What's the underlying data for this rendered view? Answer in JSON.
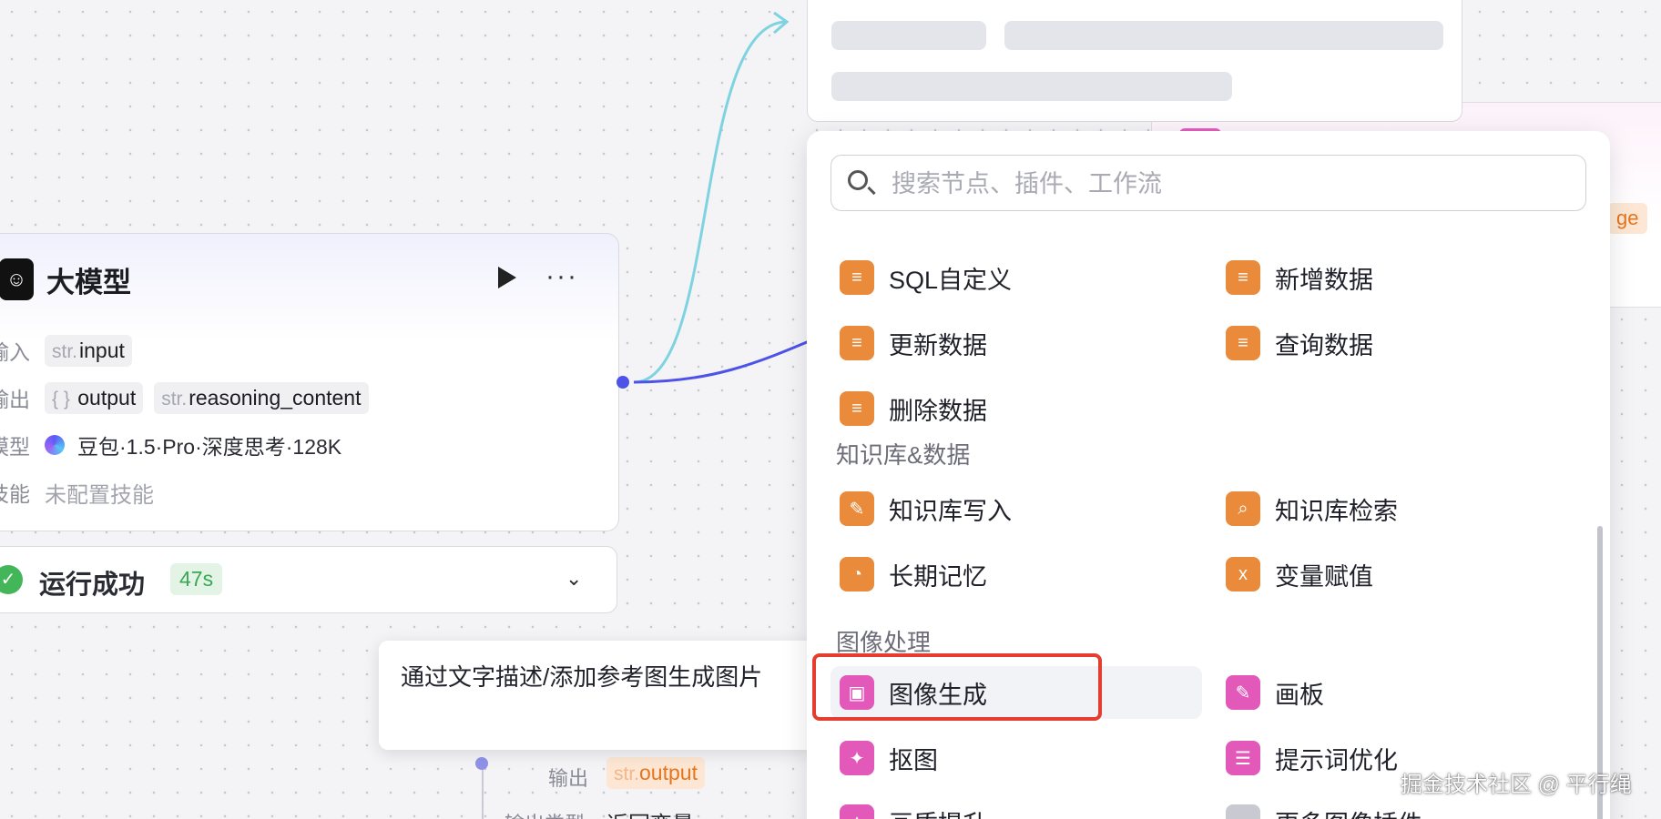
{
  "llm_node": {
    "title": "大模型",
    "input_label": "输入",
    "inputs": [
      {
        "type": "str.",
        "name": "input"
      }
    ],
    "output_label": "输出",
    "outputs": [
      {
        "type": "{ }",
        "name": "output"
      },
      {
        "type": "str.",
        "name": "reasoning_content"
      }
    ],
    "model_label": "模型",
    "model_value": "豆包·1.5·Pro·深度思考·128K",
    "skill_label": "技能",
    "skill_value": "未配置技能"
  },
  "status": {
    "text": "运行成功",
    "duration": "47s"
  },
  "tooltip": {
    "text": "通过文字描述/添加参考图生成图片"
  },
  "lower_node": {
    "output_label": "输出",
    "output_type": "str.",
    "output_name": "output",
    "output_kind_label": "输出类型",
    "output_kind_value": "返回变量"
  },
  "peek_node": {
    "tag_fragment": "ge"
  },
  "picker": {
    "search_placeholder": "搜索节点、插件、工作流",
    "database_items": [
      {
        "label": "SQL自定义",
        "icon": "database-icon"
      },
      {
        "label": "新增数据",
        "icon": "database-add-icon"
      },
      {
        "label": "更新数据",
        "icon": "database-update-icon"
      },
      {
        "label": "查询数据",
        "icon": "database-query-icon"
      },
      {
        "label": "删除数据",
        "icon": "database-delete-icon"
      }
    ],
    "knowledge_section": "知识库&数据",
    "knowledge_items": [
      {
        "label": "知识库写入",
        "icon": "knowledge-write-icon"
      },
      {
        "label": "知识库检索",
        "icon": "knowledge-search-icon"
      },
      {
        "label": "长期记忆",
        "icon": "memory-icon"
      },
      {
        "label": "变量赋值",
        "icon": "variable-assign-icon"
      }
    ],
    "image_section": "图像处理",
    "image_items": [
      {
        "label": "图像生成",
        "icon": "image-generate-icon"
      },
      {
        "label": "画板",
        "icon": "canvas-icon"
      },
      {
        "label": "抠图",
        "icon": "cutout-icon"
      },
      {
        "label": "提示词优化",
        "icon": "prompt-optimize-icon"
      },
      {
        "label": "画质提升",
        "icon": "quality-icon"
      },
      {
        "label": "更多图像插件",
        "icon": "more-icon"
      }
    ]
  },
  "watermark": "掘金技术社区 @ 平行绳",
  "colors": {
    "accent": "#4d53e8",
    "orange": "#ea8a3b",
    "pink": "#e259b9",
    "success": "#43b65a",
    "highlight": "#e53d2f"
  }
}
